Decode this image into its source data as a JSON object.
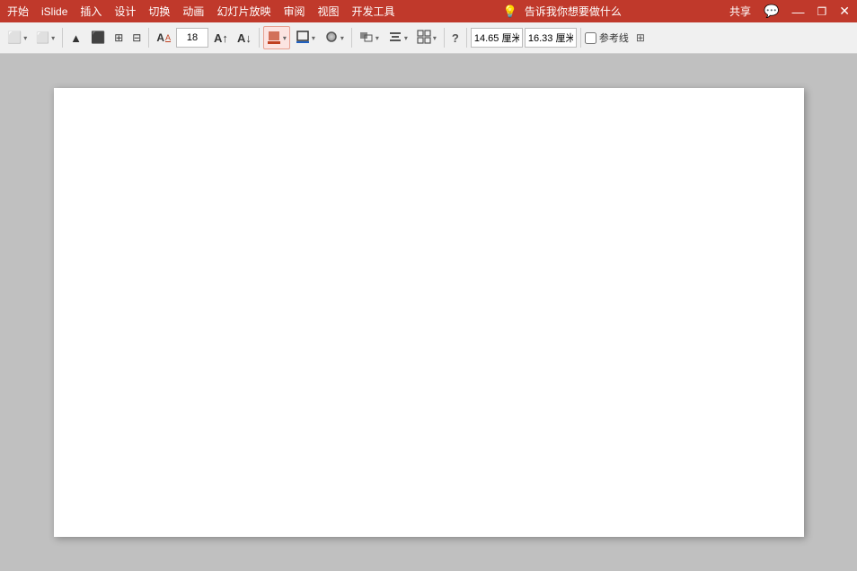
{
  "titlebar": {
    "items_left": [
      "开始",
      "iSlide",
      "插入",
      "设计",
      "切换",
      "动画",
      "幻灯片放映",
      "审阅",
      "视图",
      "开发工具"
    ],
    "tell_me": "告诉我你想要做什么",
    "share": "共享",
    "right_icon": "◻"
  },
  "toolbar": {
    "select_label": "",
    "shape_select_dropdown": "▾",
    "up_arrow": "▲",
    "group_btn": "",
    "ungroup_btn": "",
    "align_left": "",
    "font_size": "18",
    "font_size_unit": "",
    "increase_font": "",
    "decrease_font": "",
    "fill_color_btn": "",
    "outline_btn": "",
    "shape_effects_btn": "",
    "arrange_btn": "",
    "align_btn": "",
    "group_btn2": "",
    "help_btn": "?",
    "width_value": "14.65",
    "width_unit": "厘米",
    "height_value": "16.33",
    "height_unit": "厘米",
    "reference_label": "参考线",
    "reference_checkbox": false
  },
  "slide": {
    "background": "#ffffff"
  }
}
